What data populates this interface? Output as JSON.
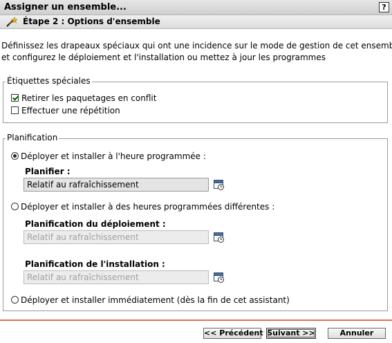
{
  "window": {
    "title": "Assigner un ensemble...",
    "help_label": "?"
  },
  "step": {
    "title": "Étape 2 : Options d'ensemble",
    "icon": "wand-icon"
  },
  "description": {
    "line1": "Définissez les drapeaux spéciaux qui ont une incidence sur le mode de gestion de cet ensemble,",
    "line2": "et configurez le déploiement et l'installation ou mettez à jour les programmes"
  },
  "special_labels": {
    "legend": "Étiquettes spéciales",
    "options": [
      {
        "label": "Retirer les paquetages en conflit",
        "checked": true
      },
      {
        "label": "Effectuer une répétition",
        "checked": false
      }
    ]
  },
  "schedule": {
    "legend": "Planification",
    "option1": {
      "label": "Déployer et installer à l'heure programmée :",
      "selected": true,
      "field_label": "Planifier :",
      "field_value": "Relatif au rafraîchissement"
    },
    "option2": {
      "label": "Déployer et installer à des heures programmées différentes :",
      "selected": false,
      "deploy_label": "Planification du déploiement :",
      "deploy_value": "Relatif au rafraîchissement",
      "install_label": "Planification de l'installation :",
      "install_value": "Relatif au rafraîchissement"
    },
    "option3": {
      "label": "Déployer et installer immédiatement (dès la fin de cet assistant)",
      "selected": false
    }
  },
  "buttons": {
    "previous": "<< Précédent",
    "next": "Suivant >>",
    "cancel": "Annuler"
  },
  "colors": {
    "separator": "#e07050",
    "checkmark": "#006000"
  }
}
